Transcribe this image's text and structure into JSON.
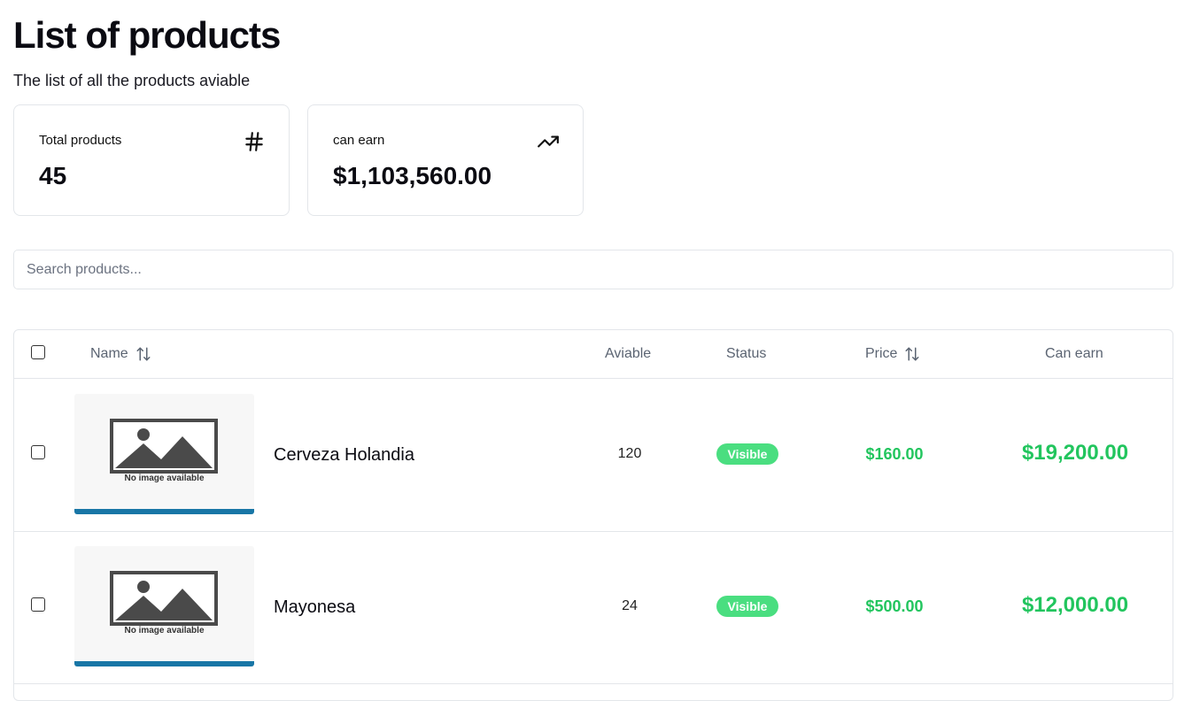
{
  "header": {
    "title": "List of products",
    "subtitle": "The list of all the products aviable"
  },
  "stats": [
    {
      "label": "Total products",
      "value": "45",
      "icon": "hash-icon"
    },
    {
      "label": "can earn",
      "value": "$1,103,560.00",
      "icon": "trending-up-icon"
    }
  ],
  "search": {
    "placeholder": "Search products...",
    "value": ""
  },
  "table": {
    "columns": {
      "name": "Name",
      "available": "Aviable",
      "status": "Status",
      "price": "Price",
      "can_earn": "Can earn"
    },
    "rows": [
      {
        "checked": false,
        "image_text": "No image available",
        "name": "Cerveza Holandia",
        "available": "120",
        "status": "Visible",
        "price": "$160.00",
        "can_earn": "$19,200.00"
      },
      {
        "checked": false,
        "image_text": "No image available",
        "name": "Mayonesa",
        "available": "24",
        "status": "Visible",
        "price": "$500.00",
        "can_earn": "$12,000.00"
      }
    ]
  },
  "colors": {
    "accent_green": "#22c55e",
    "badge_green": "#4ade80",
    "border": "#e3e6ea"
  }
}
